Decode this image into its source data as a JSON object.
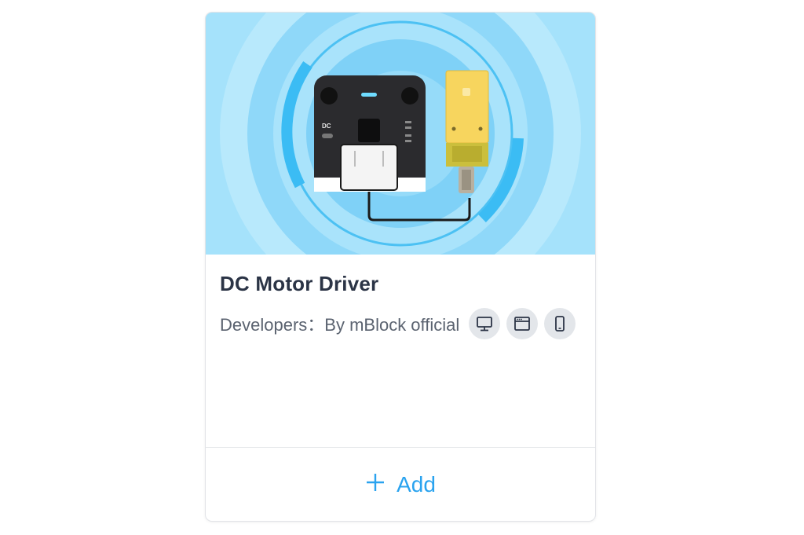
{
  "card": {
    "title": "DC Motor Driver",
    "developers": "Developers：By mBlock official",
    "platform_icons": [
      "desktop-icon",
      "browser-window-icon",
      "mobile-icon"
    ],
    "hero_label": "DC",
    "action": {
      "icon": "plus-icon",
      "label": "Add"
    }
  },
  "colors": {
    "hero_background": "#a5e2fb",
    "ring_accent": "#3bbcf4",
    "board": "#2b2b2e",
    "motor": "#f7d55e",
    "title": "#2b3446",
    "text_secondary": "#5b6370",
    "accent": "#2aa3ef",
    "badge_background": "#e3e6ea"
  }
}
